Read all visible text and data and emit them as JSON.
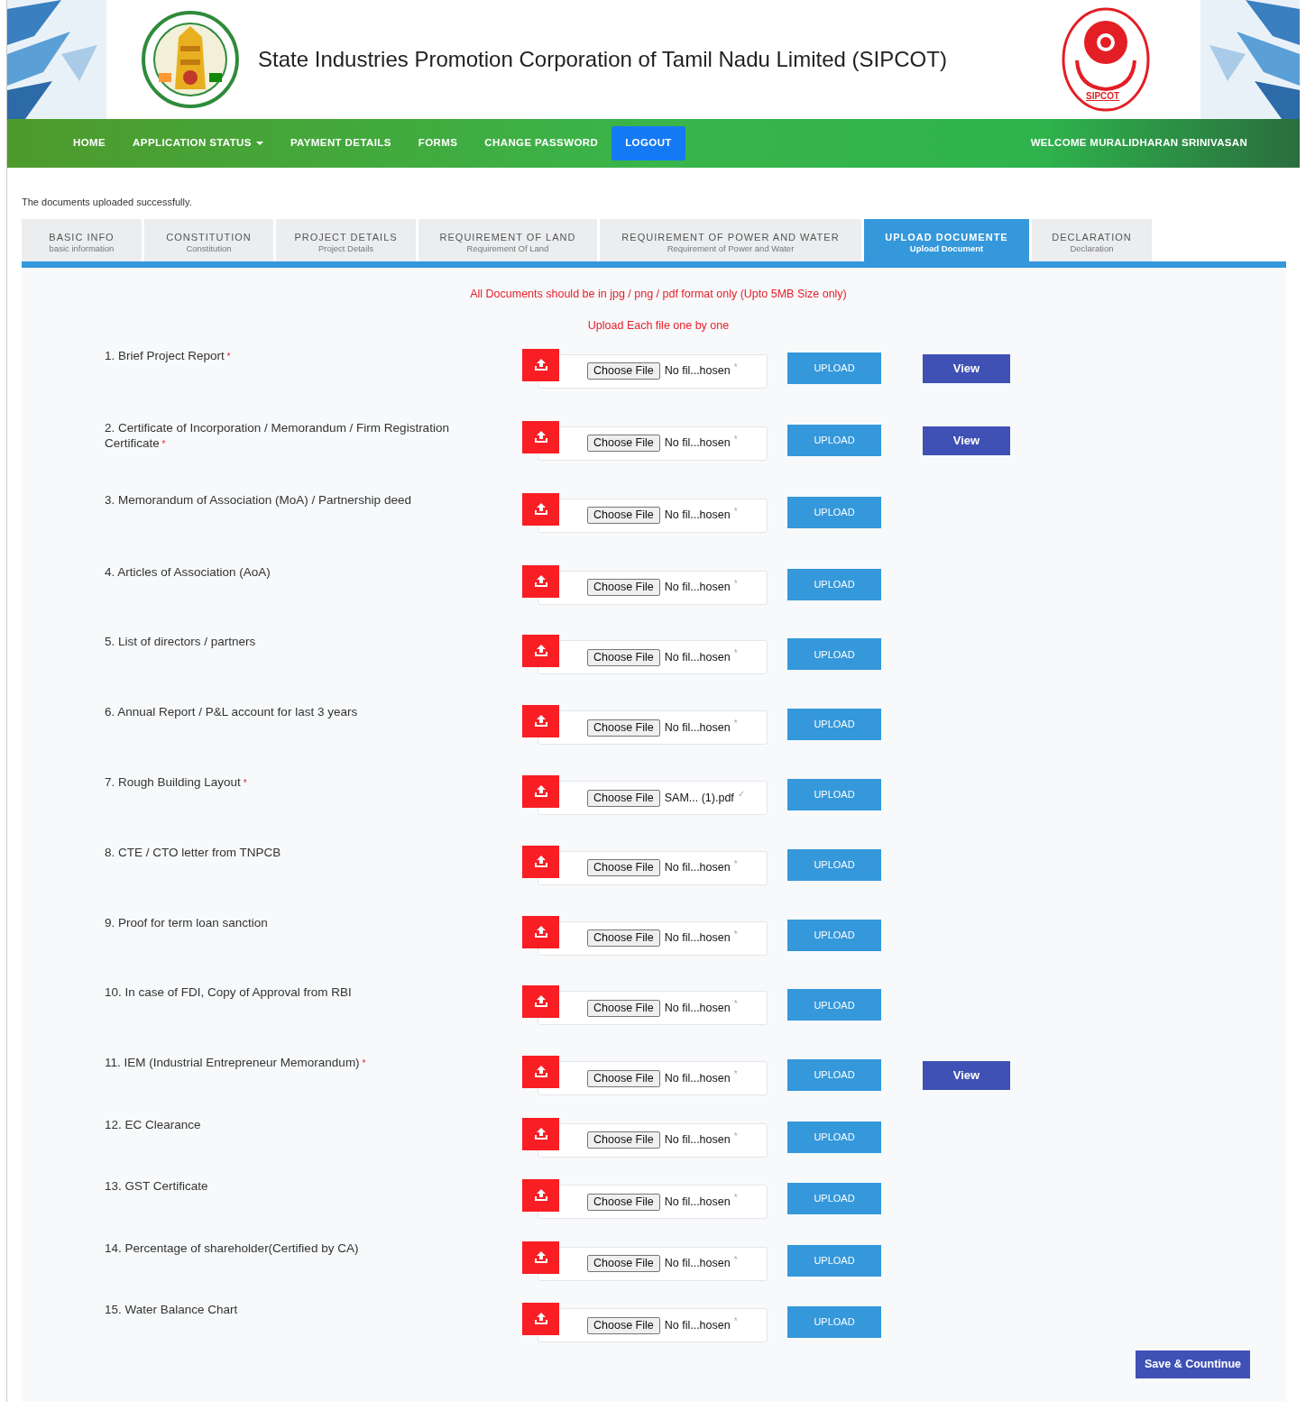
{
  "header": {
    "title": "State Industries Promotion Corporation of Tamil Nadu Limited (SIPCOT)",
    "right_logo_text": "SIPCOT"
  },
  "nav": {
    "items": [
      {
        "label": "HOME",
        "dropdown": false,
        "selected": false
      },
      {
        "label": "APPLICATION STATUS",
        "dropdown": true,
        "selected": false
      },
      {
        "label": "PAYMENT DETAILS",
        "dropdown": false,
        "selected": false
      },
      {
        "label": "FORMS",
        "dropdown": false,
        "selected": false
      },
      {
        "label": "CHANGE PASSWORD",
        "dropdown": false,
        "selected": false
      },
      {
        "label": "LOGOUT",
        "dropdown": false,
        "selected": true
      }
    ],
    "welcome": "WELCOME MURALIDHARAN SRINIVASAN"
  },
  "message": "The documents uploaded successfully.",
  "tabs": [
    {
      "title": "BASIC INFO",
      "subtitle": "basic information",
      "selected": false
    },
    {
      "title": "CONSTITUTION",
      "subtitle": "Constitution",
      "selected": false
    },
    {
      "title": "PROJECT DETAILS",
      "subtitle": "Project Details",
      "selected": false
    },
    {
      "title": "REQUIREMENT OF LAND",
      "subtitle": "Requirement Of Land",
      "selected": false
    },
    {
      "title": "REQUIREMENT OF POWER AND WATER",
      "subtitle": "Requirement of Power and Water",
      "selected": false
    },
    {
      "title": "UPLOAD DOCUMENTE",
      "subtitle": "Upload Document",
      "selected": true
    },
    {
      "title": "DECLARATION",
      "subtitle": "Declaration",
      "selected": false
    }
  ],
  "notes": [
    "All Documents should be in jpg / png / pdf format only (Upto 5MB Size only)",
    "Upload Each file one by one"
  ],
  "documents": [
    {
      "label": "1. Brief Project Report",
      "required_mark": "*",
      "choose_label": "Choose File",
      "file_name": "No fil...hosen",
      "status_mark": "*",
      "upload_label": "UPLOAD",
      "view_label": "View"
    },
    {
      "label": "2. Certificate of Incorporation / Memorandum / Firm Registration Certificate",
      "required_mark": "*",
      "choose_label": "Choose File",
      "file_name": "No fil...hosen",
      "status_mark": "*",
      "upload_label": "UPLOAD",
      "view_label": "View"
    },
    {
      "label": "3. Memorandum of Association (MoA) / Partnership deed",
      "choose_label": "Choose File",
      "file_name": "No fil...hosen",
      "status_mark": "*",
      "upload_label": "UPLOAD"
    },
    {
      "label": "4. Articles of Association (AoA)",
      "choose_label": "Choose File",
      "file_name": "No fil...hosen",
      "status_mark": "*",
      "upload_label": "UPLOAD"
    },
    {
      "label": "5. List of directors / partners",
      "choose_label": "Choose File",
      "file_name": "No fil...hosen",
      "status_mark": "*",
      "upload_label": "UPLOAD"
    },
    {
      "label": "6. Annual Report / P&L account for last 3 years",
      "choose_label": "Choose File",
      "file_name": "No fil...hosen",
      "status_mark": "*",
      "upload_label": "UPLOAD"
    },
    {
      "label": "7. Rough Building Layout",
      "required_mark": "*",
      "choose_label": "Choose File",
      "file_name": "SAM... (1).pdf",
      "status_mark": "✓",
      "upload_label": "UPLOAD"
    },
    {
      "label": "8. CTE / CTO letter from TNPCB",
      "choose_label": "Choose File",
      "file_name": "No fil...hosen",
      "status_mark": "*",
      "upload_label": "UPLOAD"
    },
    {
      "label": "9. Proof for term loan sanction",
      "choose_label": "Choose File",
      "file_name": "No fil...hosen",
      "status_mark": "*",
      "upload_label": "UPLOAD"
    },
    {
      "label": "10. In case of FDI, Copy of Approval from RBI",
      "choose_label": "Choose File",
      "file_name": "No fil...hosen",
      "status_mark": "*",
      "upload_label": "UPLOAD"
    },
    {
      "label": "11. IEM (Industrial Entrepreneur Memorandum)",
      "required_mark": "*",
      "choose_label": "Choose File",
      "file_name": "No fil...hosen",
      "status_mark": "*",
      "upload_label": "UPLOAD",
      "view_label": "View"
    },
    {
      "label": "12. EC Clearance",
      "choose_label": "Choose File",
      "file_name": "No fil...hosen",
      "status_mark": "*",
      "upload_label": "UPLOAD"
    },
    {
      "label": "13. GST Certificate",
      "choose_label": "Choose File",
      "file_name": "No fil...hosen",
      "status_mark": "*",
      "upload_label": "UPLOAD"
    },
    {
      "label": "14. Percentage of shareholder(Certified by CA)",
      "choose_label": "Choose File",
      "file_name": "No fil...hosen",
      "status_mark": "*",
      "upload_label": "UPLOAD"
    },
    {
      "label": "15. Water Balance Chart",
      "choose_label": "Choose File",
      "file_name": "No fil...hosen",
      "status_mark": "*",
      "upload_label": "UPLOAD"
    }
  ],
  "save_button": "Save & Countinue"
}
